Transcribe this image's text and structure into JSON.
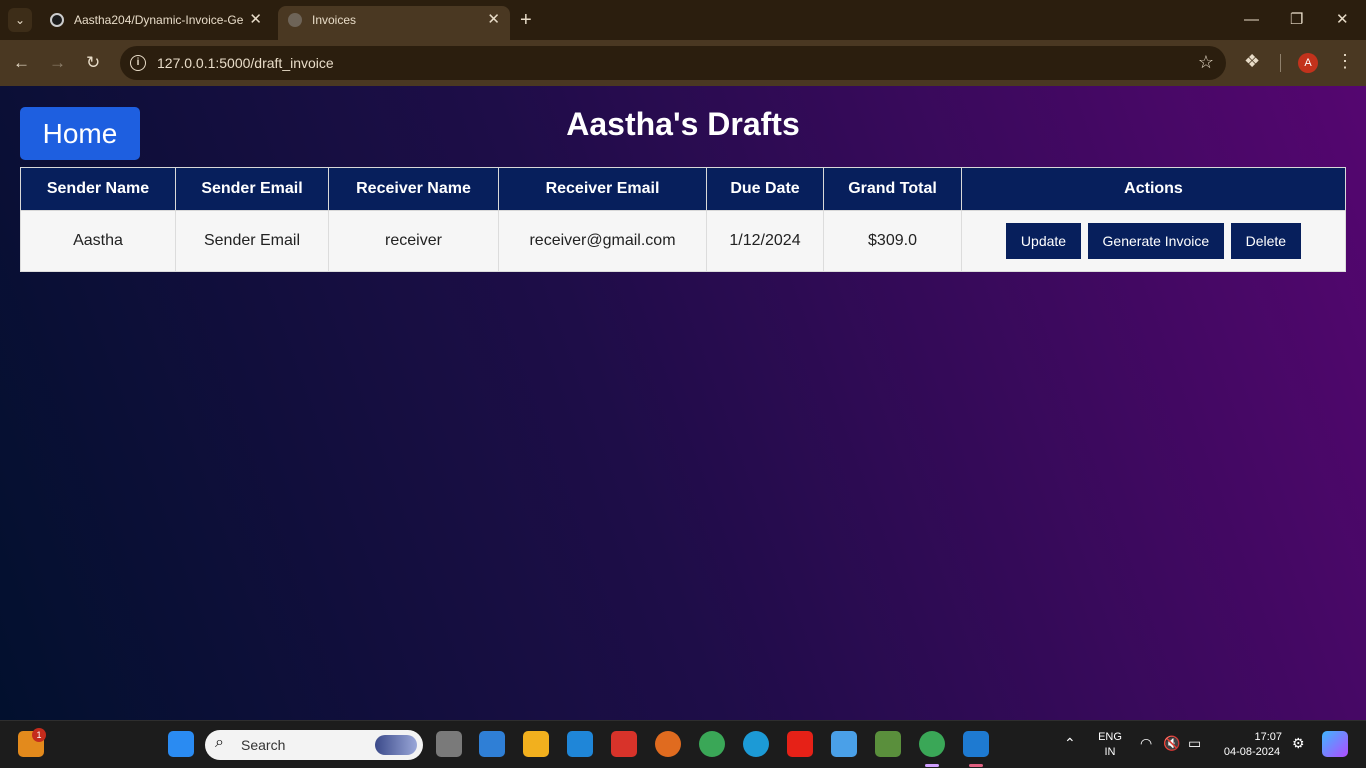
{
  "browser": {
    "tabs": [
      {
        "title": "Aastha204/Dynamic-Invoice-Ge",
        "active": false
      },
      {
        "title": "Invoices",
        "active": true
      }
    ],
    "url": "127.0.0.1:5000/draft_invoice",
    "profile_initial": "A"
  },
  "page": {
    "home_label": "Home",
    "title": "Aastha's Drafts",
    "table": {
      "headers": [
        "Sender Name",
        "Sender Email",
        "Receiver Name",
        "Receiver Email",
        "Due Date",
        "Grand Total",
        "Actions"
      ],
      "rows": [
        {
          "sender_name": "Aastha",
          "sender_email": "Sender Email",
          "receiver_name": "receiver",
          "receiver_email": "receiver@gmail.com",
          "due_date": "1/12/2024",
          "grand_total": "$309.0",
          "actions": {
            "update": "Update",
            "generate": "Generate Invoice",
            "delete": "Delete"
          }
        }
      ]
    }
  },
  "taskbar": {
    "widget_badge": "1",
    "search_placeholder": "Search",
    "language": {
      "line1": "ENG",
      "line2": "IN"
    },
    "time": "17:07",
    "date": "04-08-2024"
  },
  "colors": {
    "accent_button": "#1e5fe0",
    "table_header": "#071f5c",
    "gradient_start": "#02102e",
    "gradient_end": "#550670"
  }
}
